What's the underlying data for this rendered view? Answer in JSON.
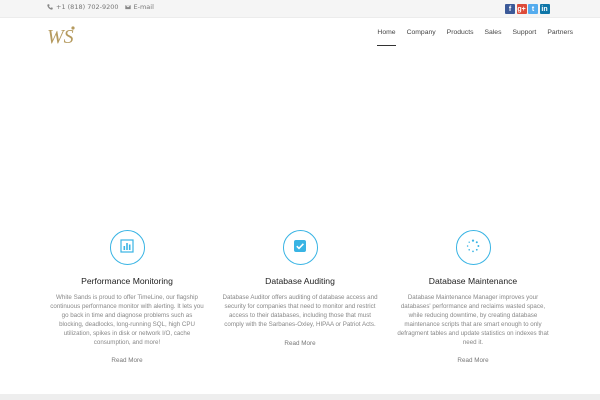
{
  "topbar": {
    "phone": "+1 (818) 702-9200",
    "email_label": "E-mail",
    "social": [
      {
        "icon": "facebook-icon",
        "glyph": "f",
        "color": "#3b5998"
      },
      {
        "icon": "google-plus-icon",
        "glyph": "g+",
        "color": "#dd4b39"
      },
      {
        "icon": "twitter-icon",
        "glyph": "t",
        "color": "#55acee"
      },
      {
        "icon": "linkedin-icon",
        "glyph": "in",
        "color": "#0e76a8"
      }
    ]
  },
  "header": {
    "logo_text": "WS",
    "nav": [
      {
        "label": "Home",
        "active": true
      },
      {
        "label": "Company"
      },
      {
        "label": "Products"
      },
      {
        "label": "Sales"
      },
      {
        "label": "Support"
      },
      {
        "label": "Partners"
      }
    ]
  },
  "features": [
    {
      "icon": "bar-chart-icon",
      "title": "Performance Monitoring",
      "text": "White Sands is proud to offer TimeLine, our flagship continuous performance monitor with alerting. It lets you go back in time and diagnose problems such as blocking, deadlocks, long-running SQL, high CPU utilization, spikes in disk or network I/O, cache consumption, and more!",
      "link": "Read More"
    },
    {
      "icon": "checkbox-icon",
      "title": "Database Auditing",
      "text": "Database Auditor offers auditing of database access and security for companies that need to monitor and restrict access to their databases, including those that must comply with the Sarbanes-Oxley, HIPAA or Patriot Acts.",
      "link": "Read More"
    },
    {
      "icon": "spinner-icon",
      "title": "Database Maintenance",
      "text": "Database Maintenance Manager improves your databases' performance and reclaims wasted space, while reducing downtime, by creating database maintenance scripts that are smart enough to only defragment tables and update statistics on indexes that need it.",
      "link": "Read More"
    }
  ],
  "colors": {
    "accent": "#39b4e4",
    "logo_gold": "#b59a5e"
  }
}
